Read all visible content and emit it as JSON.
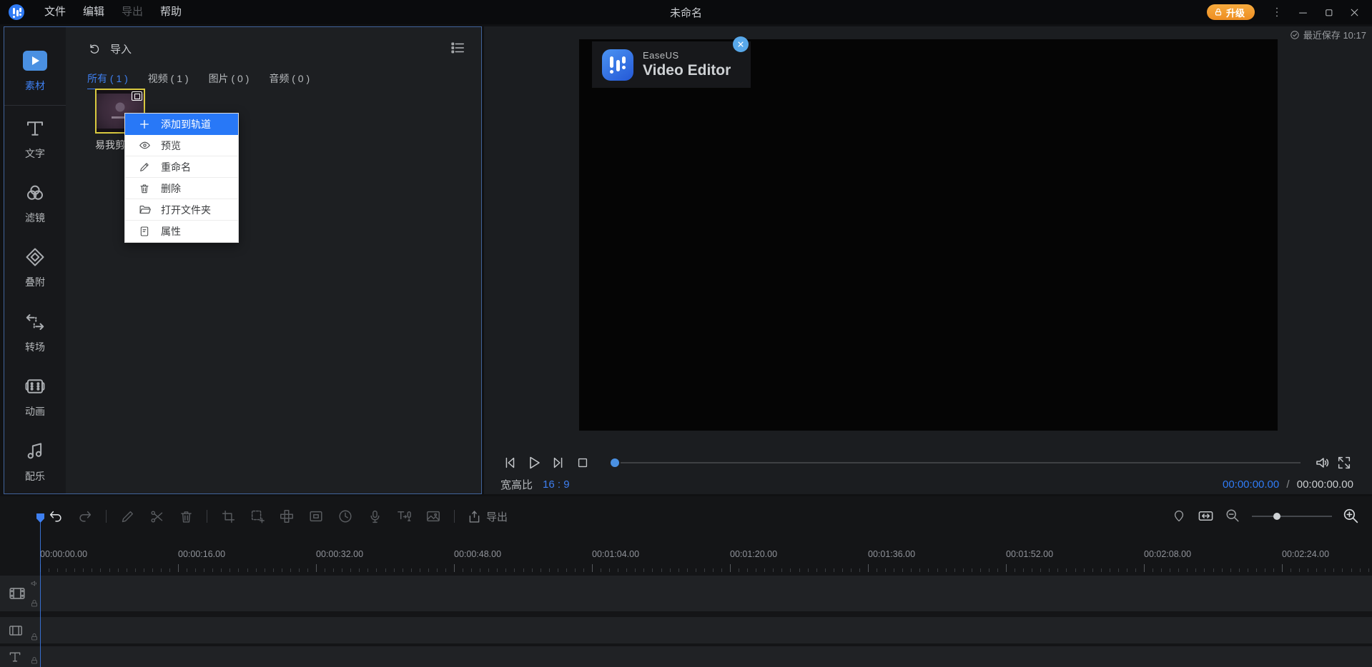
{
  "app": {
    "menu": {
      "file": "文件",
      "edit": "编辑",
      "export": "导出",
      "help": "帮助"
    },
    "title": "未命名",
    "upgrade_label": "升级",
    "last_saved": "最近保存 10:17"
  },
  "sidebar": {
    "items": [
      {
        "label": "素材",
        "icon": "media-icon",
        "active": true
      },
      {
        "label": "文字",
        "icon": "text-icon",
        "active": false
      },
      {
        "label": "滤镜",
        "icon": "filter-icon",
        "active": false
      },
      {
        "label": "叠附",
        "icon": "overlay-icon",
        "active": false
      },
      {
        "label": "转场",
        "icon": "transition-icon",
        "active": false
      },
      {
        "label": "动画",
        "icon": "animation-icon",
        "active": false
      },
      {
        "label": "配乐",
        "icon": "music-icon",
        "active": false
      }
    ]
  },
  "media_panel": {
    "import_label": "导入",
    "tabs": [
      {
        "label": "所有 ( 1 )",
        "active": true
      },
      {
        "label": "视频 ( 1 )",
        "active": false
      },
      {
        "label": "图片 ( 0 )",
        "active": false
      },
      {
        "label": "音频 ( 0 )",
        "active": false
      }
    ],
    "clip_name": "易我剪辑"
  },
  "context_menu": {
    "items": [
      {
        "label": "添加到轨道",
        "icon": "plus-icon",
        "highlighted": true
      },
      {
        "label": "预览",
        "icon": "eye-icon",
        "highlighted": false
      },
      {
        "label": "重命名",
        "icon": "pencil-icon",
        "highlighted": false
      },
      {
        "label": "删除",
        "icon": "trash-icon",
        "highlighted": false
      },
      {
        "label": "打开文件夹",
        "icon": "folder-icon",
        "highlighted": false
      },
      {
        "label": "属性",
        "icon": "properties-icon",
        "highlighted": false
      }
    ]
  },
  "preview": {
    "watermark_brand": "EaseUS",
    "watermark_product": "Video Editor",
    "aspect_label": "宽高比",
    "aspect_value": "16 : 9",
    "current_time": "00:00:00.00",
    "separator": "/",
    "total_time": "00:00:00.00"
  },
  "timeline": {
    "export_label": "导出",
    "ruler_labels": [
      "00:00:00.00",
      "00:00:16.00",
      "00:00:32.00",
      "00:00:48.00",
      "00:01:04.00",
      "00:01:20.00",
      "00:01:36.00",
      "00:01:52.00",
      "00:02:08.00",
      "00:02:24.00"
    ]
  },
  "colors": {
    "accent_blue": "#2f7bf5",
    "menu_highlight": "#2878f7",
    "upgrade_orange": "#ee8e22",
    "selection_yellow": "#d9c93f",
    "panel_border_blue": "#41639b"
  }
}
